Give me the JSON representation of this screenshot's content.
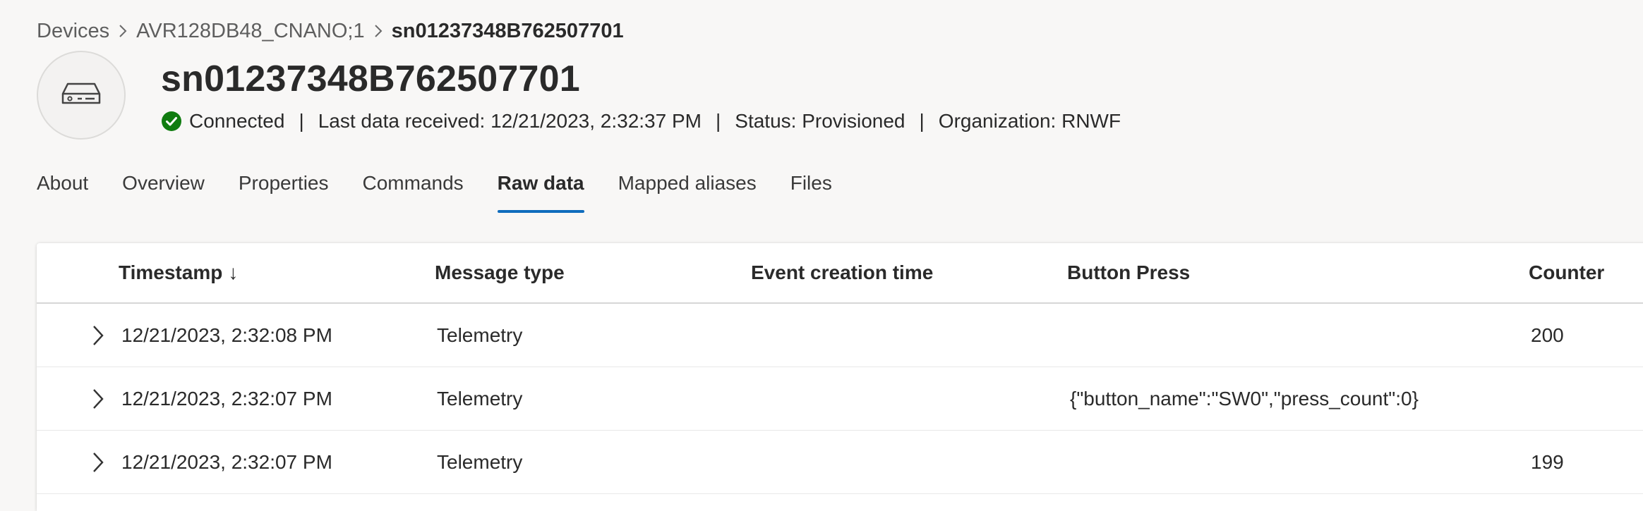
{
  "breadcrumb": {
    "items": [
      "Devices",
      "AVR128DB48_CNANO;1",
      "sn01237348B762507701"
    ]
  },
  "device": {
    "icon": "device-hub-icon",
    "title": "sn01237348B762507701",
    "connection": "Connected",
    "last_data": "Last data received: 12/21/2023, 2:32:37 PM",
    "status": "Status: Provisioned",
    "organization": "Organization: RNWF",
    "status_color": "#107c10"
  },
  "tabs": [
    {
      "label": "About",
      "active": false
    },
    {
      "label": "Overview",
      "active": false
    },
    {
      "label": "Properties",
      "active": false
    },
    {
      "label": "Commands",
      "active": false
    },
    {
      "label": "Raw data",
      "active": true
    },
    {
      "label": "Mapped aliases",
      "active": false
    },
    {
      "label": "Files",
      "active": false
    }
  ],
  "accent_color": "#0f6cbd",
  "grid": {
    "columns": {
      "timestamp": "Timestamp",
      "sort_indicator": "↓",
      "message_type": "Message type",
      "event_creation_time": "Event creation time",
      "button_press": "Button Press",
      "counter": "Counter"
    },
    "rows": [
      {
        "timestamp": "12/21/2023, 2:32:08 PM",
        "message_type": "Telemetry",
        "event_creation_time": "",
        "button_press": "",
        "counter": "200"
      },
      {
        "timestamp": "12/21/2023, 2:32:07 PM",
        "message_type": "Telemetry",
        "event_creation_time": "",
        "button_press": "{\"button_name\":\"SW0\",\"press_count\":0}",
        "counter": ""
      },
      {
        "timestamp": "12/21/2023, 2:32:07 PM",
        "message_type": "Telemetry",
        "event_creation_time": "",
        "button_press": "",
        "counter": "199"
      }
    ]
  }
}
